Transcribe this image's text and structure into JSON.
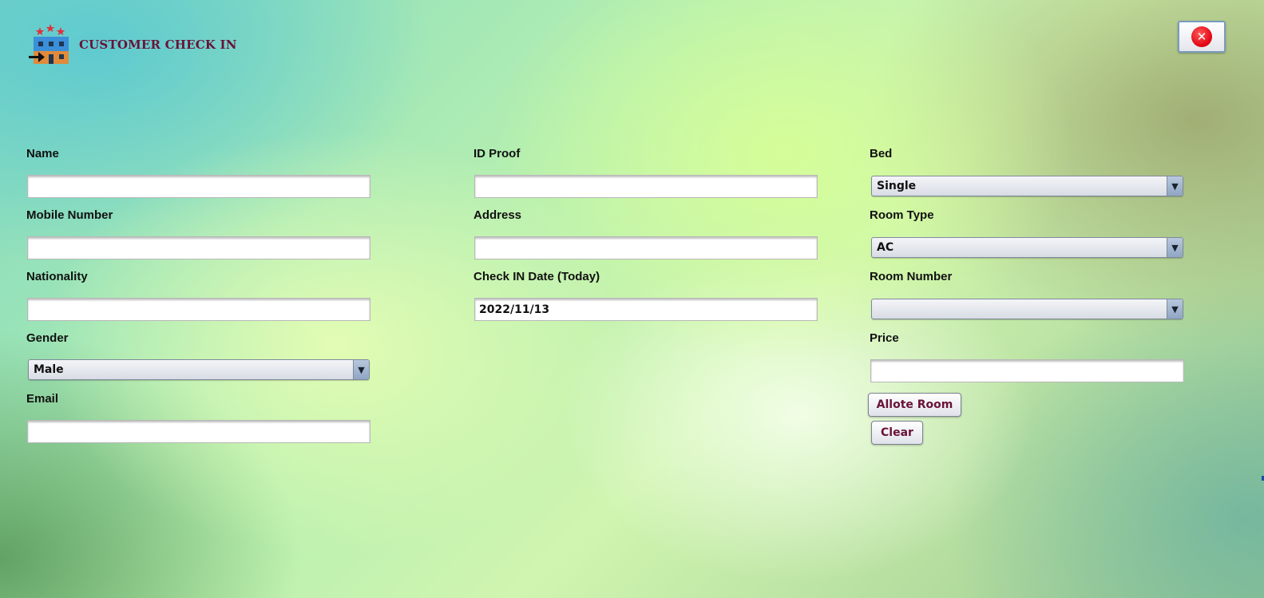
{
  "header": {
    "title": "CUSTOMER CHECK IN",
    "logo_icon": "hotel-check-in-icon",
    "close_icon": "close-icon"
  },
  "form": {
    "name": {
      "label": "Name",
      "value": ""
    },
    "mobile": {
      "label": "Mobile Number",
      "value": ""
    },
    "nationality": {
      "label": "Nationality",
      "value": ""
    },
    "gender": {
      "label": "Gender",
      "value": "Male"
    },
    "email": {
      "label": "Email",
      "value": ""
    },
    "id_proof": {
      "label": "ID Proof",
      "value": ""
    },
    "address": {
      "label": "Address",
      "value": ""
    },
    "check_in_date": {
      "label": "Check IN Date (Today)",
      "value": "2022/11/13"
    },
    "bed": {
      "label": "Bed",
      "value": "Single"
    },
    "room_type": {
      "label": "Room Type",
      "value": "AC"
    },
    "room_number": {
      "label": "Room Number",
      "value": ""
    },
    "price": {
      "label": "Price",
      "value": ""
    }
  },
  "buttons": {
    "allote": "Allote Room",
    "clear": "Clear"
  },
  "icons": {
    "dropdown_arrow": "▼",
    "close_glyph": "✕"
  },
  "colors": {
    "title": "#6a1238",
    "button_text": "#6a1238",
    "close_icon": "#e00010"
  }
}
